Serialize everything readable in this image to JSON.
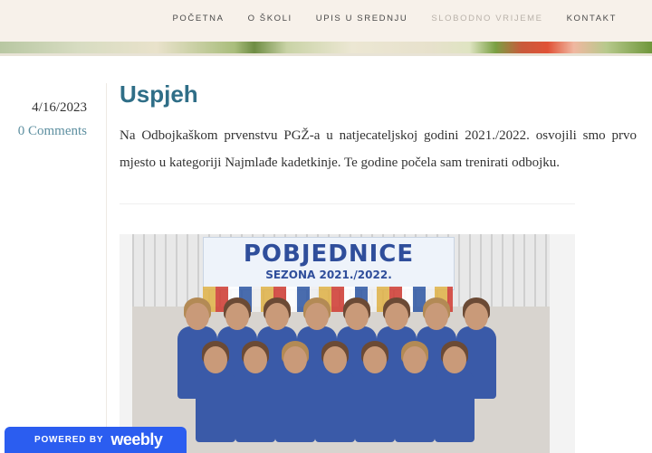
{
  "nav": {
    "items": [
      {
        "label": "POČETNA"
      },
      {
        "label": "O ŠKOLI"
      },
      {
        "label": "UPIS U SREDNJU"
      },
      {
        "label": "SLOBODNO VRIJEME"
      },
      {
        "label": "KONTAKT"
      }
    ],
    "active_index": 3
  },
  "post": {
    "date": "4/16/2023",
    "comments_link": "0 Comments",
    "title": "Uspjeh",
    "body": "Na Odbojkaškom prvenstvu PGŽ-a u natjecateljskoj godini 2021./2022. osvojili smo prvo mjesto u kategoriji Najmlađe kadetkinje. Te godine počela sam trenirati odbojku.",
    "photo": {
      "banner_title": "POBJEDNICE",
      "banner_subtitle": "SEZONA 2021./2022."
    }
  },
  "footer_badge": {
    "powered_by": "POWERED BY",
    "brand": "weebly"
  },
  "colors": {
    "title": "#2f6e87",
    "link": "#5d8fa0",
    "nav_active": "#b9b2aa",
    "badge": "#2b5df0"
  }
}
